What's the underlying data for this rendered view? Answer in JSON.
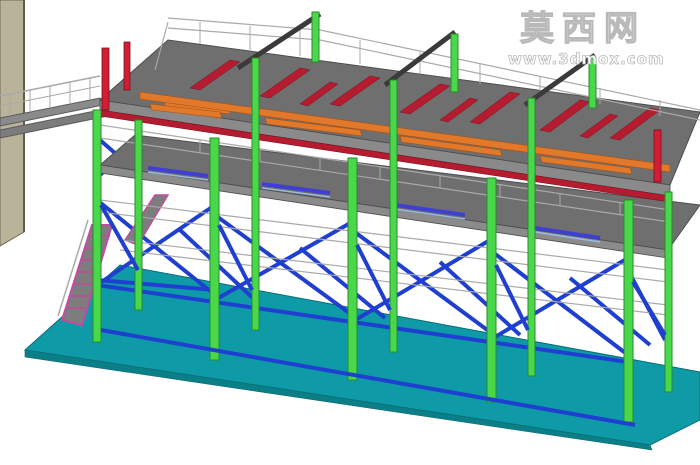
{
  "watermark": {
    "logo_text": "莫西网",
    "url": "www.3dmox.com"
  },
  "colors": {
    "background": "#ffffff",
    "base_slab": "#0e9aa7",
    "column": "#49d84a",
    "brace": "#1f3fd1",
    "deck": "#6f6f6f",
    "railing": "#a9a9a9",
    "red_member": "#d21e35",
    "orange_member": "#e2792a",
    "stair": "#c24aa0",
    "wall": "#b9b39a"
  }
}
